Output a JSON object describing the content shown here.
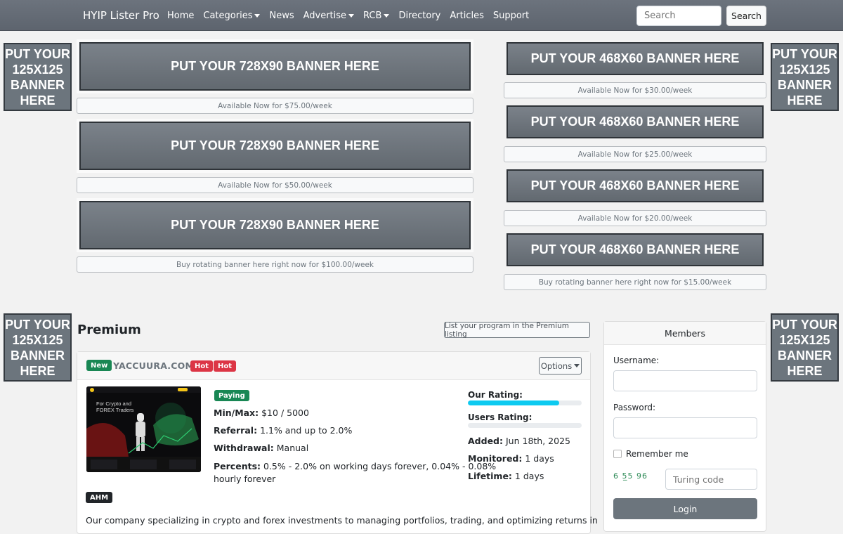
{
  "nav": {
    "brand": "HYIP Lister Pro",
    "links": [
      {
        "label": "Home",
        "dropdown": false
      },
      {
        "label": "Categories",
        "dropdown": true
      },
      {
        "label": "News",
        "dropdown": false
      },
      {
        "label": "Advertise",
        "dropdown": true
      },
      {
        "label": "RCB",
        "dropdown": true
      },
      {
        "label": "Directory",
        "dropdown": false
      },
      {
        "label": "Articles",
        "dropdown": false
      },
      {
        "label": "Support",
        "dropdown": false
      }
    ],
    "search_placeholder": "Search",
    "search_button": "Search"
  },
  "ads": {
    "square": "PUT YOUR 125X125 BANNER HERE",
    "banner728": "PUT YOUR 728X90 BANNER HERE",
    "banner468": "PUT YOUR 468X60 BANNER HERE",
    "left_slots": [
      "Available Now for $75.00/week",
      "Available Now for $50.00/week",
      "Buy rotating banner here right now for $100.00/week"
    ],
    "right_slots": [
      "Available Now for $30.00/week",
      "Available Now for $25.00/week",
      "Available Now for $20.00/week",
      "Buy rotating banner here right now for $15.00/week"
    ]
  },
  "premium": {
    "title": "Premium",
    "list_button": "List your program in the Premium listing"
  },
  "program": {
    "new_badge": "New",
    "name": "YACCUURA.COM",
    "hot_badges": [
      "Hot",
      "Hot"
    ],
    "options_label": "Options",
    "thumb_text": "For Crypto and FOREX Traders",
    "status_badge": "Paying",
    "minmax_label": "Min/Max:",
    "minmax_value": "$10 / 5000",
    "referral_label": "Referral:",
    "referral_value": "1.1% and up to 2.0%",
    "withdrawal_label": "Withdrawal:",
    "withdrawal_value": "Manual",
    "percents_label": "Percents:",
    "percents_value_line1": "0.5% - 2.0% on working days forever, 0.04% - 0.08%",
    "percents_value_line2": "hourly forever",
    "our_rating_label": "Our Rating:",
    "our_rating": 0.8,
    "users_rating_label": "Users Rating:",
    "users_rating": 0,
    "added_label": "Added:",
    "added_value": "Jun 18th, 2025",
    "monitored_label": "Monitored:",
    "monitored_value": "1 days",
    "lifetime_label": "Lifetime:",
    "lifetime_value": "1 days",
    "tag_badge": "AHM",
    "description": "Our company specializing in crypto and forex investments to managing portfolios, trading, and optimizing returns in"
  },
  "members": {
    "title": "Members",
    "username_label": "Username:",
    "password_label": "Password:",
    "remember_label": "Remember me",
    "captcha": "6 5̲5 96",
    "turing_placeholder": "Turing code",
    "login_button": "Login"
  },
  "colors": {
    "navbar": "#5d646e",
    "banner": "#6c757d",
    "success": "#198754",
    "danger": "#dc3545",
    "rating_bar": "#0dcaf0"
  }
}
